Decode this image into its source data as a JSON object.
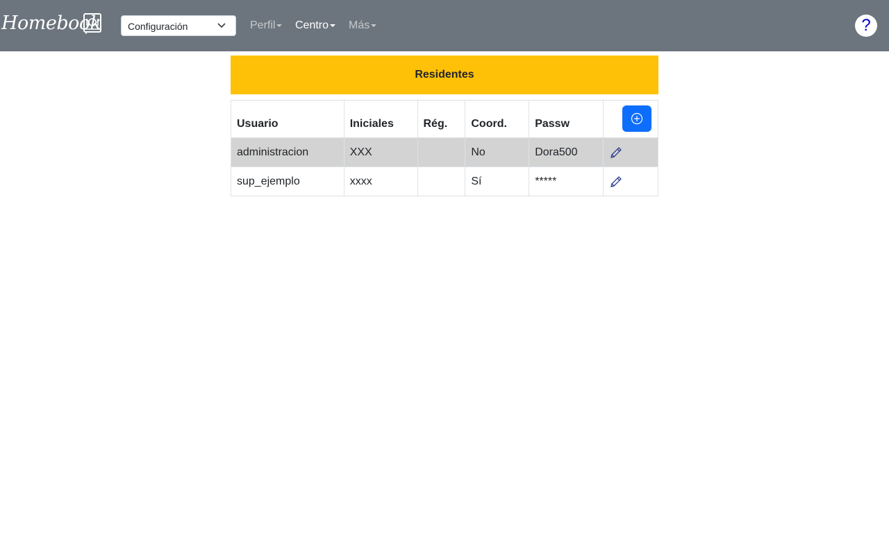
{
  "brand": {
    "name": "Homebook",
    "icon": "food-book-icon"
  },
  "config_select": {
    "value": "Configuración"
  },
  "nav": [
    {
      "label": "Perfil"
    },
    {
      "label": "Centro"
    },
    {
      "label": "Más"
    }
  ],
  "help": {
    "label": "?"
  },
  "banner": {
    "title": "Residentes"
  },
  "table": {
    "headers": [
      "Usuario",
      "Iniciales",
      "Rég.",
      "Coord.",
      "Passw"
    ],
    "rows": [
      {
        "usuario": "administracion",
        "iniciales": "XXX",
        "reg": "",
        "coord": "No",
        "passw": "Dora500"
      },
      {
        "usuario": "sup_ejemplo",
        "iniciales": "xxxx",
        "reg": "",
        "coord": "Sí",
        "passw": "*****"
      }
    ]
  },
  "colors": {
    "navbar": "#6c757d",
    "banner": "#ffc107",
    "primary": "#0d6efd",
    "shaded_row": "#d3d3d3"
  }
}
